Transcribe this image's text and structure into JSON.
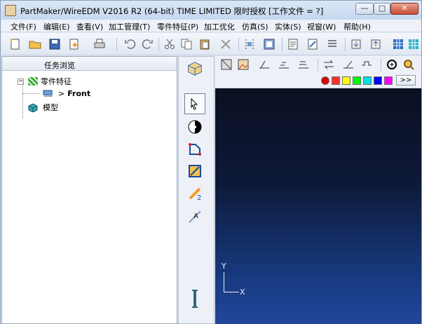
{
  "window": {
    "title": "PartMaker/WireEDM V2016 R2 (64-bit) TIME LIMITED 限时授权   [工作文件 = ?]",
    "controls": {
      "minimize": "—",
      "maximize": "□",
      "close": "✕"
    }
  },
  "menubar": {
    "items": [
      "文件(F)",
      "编辑(E)",
      "查看(V)",
      "加工管理(T)",
      "零件特征(P)",
      "加工优化",
      "仿真(S)",
      "实体(S)",
      "视窗(W)",
      "帮助(H)"
    ]
  },
  "left_pane": {
    "title": "任务浏览",
    "tree": {
      "root": "零件特征",
      "child_prefix": ">",
      "child": "Front",
      "second": "模型"
    }
  },
  "color_palette": {
    "colors": [
      "#e00000",
      "#ff3030",
      "#ffff00",
      "#00ff00",
      "#00e0e0",
      "#0000ff",
      "#ff00ff"
    ],
    "more_label": ">>"
  },
  "viewport": {
    "axis_y": "Y",
    "axis_x": "X"
  },
  "icons": {
    "toolbar": [
      "new-file-icon",
      "open-folder-icon",
      "save-icon",
      "export-icon",
      "print-icon",
      "undo-icon",
      "redo-icon",
      "cut-icon",
      "copy-icon",
      "paste-icon",
      "delete-icon",
      "align-icon",
      "frame-icon",
      "document-icon",
      "edit-document-icon",
      "list-icon",
      "import-icon",
      "export-2-icon",
      "grid-icon",
      "color-grid-icon"
    ],
    "mid": [
      "select-arrow-icon",
      "color-wheel-icon",
      "polyline-icon",
      "rectangle-icon",
      "measure-icon",
      "text-icon",
      "vertical-bar-icon"
    ]
  }
}
